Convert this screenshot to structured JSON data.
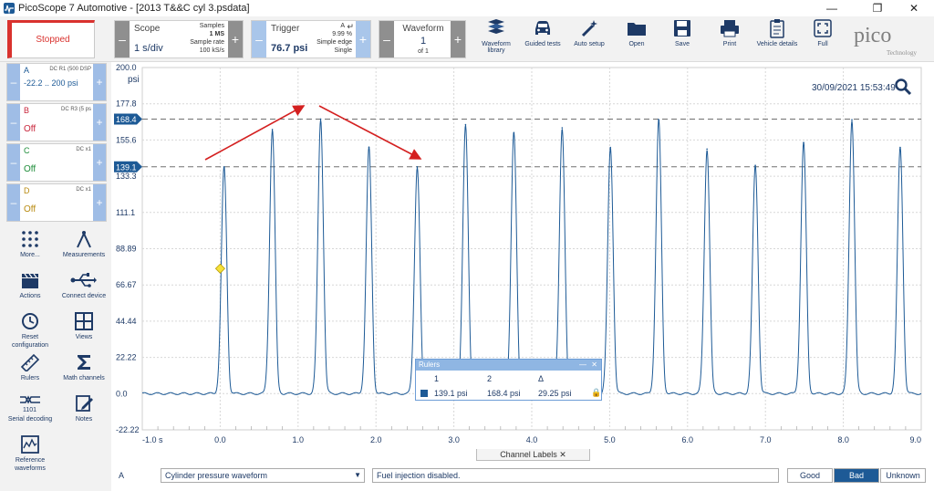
{
  "window": {
    "title": "PicoScope 7 Automotive - [2013 T&&C cyl 3.psdata]"
  },
  "run_status": {
    "label": "Stopped",
    "color": "#d9322e"
  },
  "scope_panel": {
    "label": "Scope",
    "value": "1 s/div",
    "samples_label": "Samples",
    "samples_value": "1 MS",
    "rate_label": "Sample rate",
    "rate_value": "100 kS/s"
  },
  "trigger_panel": {
    "label": "Trigger",
    "channel": "A",
    "percent": "9.99 %",
    "value": "76.7 psi",
    "type": "Simple edge",
    "mode": "Single"
  },
  "waveform_panel": {
    "label": "Waveform",
    "index": "1",
    "of": "of 1"
  },
  "toolbar": [
    {
      "label": "Waveform library",
      "icon": "books-icon"
    },
    {
      "label": "Guided tests",
      "icon": "car-icon"
    },
    {
      "label": "Auto setup",
      "icon": "magic-wand-icon"
    },
    {
      "label": "Open",
      "icon": "folder-icon"
    },
    {
      "label": "Save",
      "icon": "save-icon"
    },
    {
      "label": "Print",
      "icon": "printer-icon"
    },
    {
      "label": "Vehicle details",
      "icon": "clipboard-icon"
    },
    {
      "label": "Full",
      "icon": "fullscreen-icon"
    }
  ],
  "brand": {
    "name": "pico",
    "sub": "Technology"
  },
  "channels": [
    {
      "name": "A",
      "color": "#1d5a96",
      "value": "-22.2 .. 200 psi",
      "settings": "DC R1 (500 DSP"
    },
    {
      "name": "B",
      "color": "#c8253b",
      "value": "Off",
      "settings": "DC R3 (5 ps"
    },
    {
      "name": "C",
      "color": "#1e8c3a",
      "value": "Off",
      "settings": "DC x1"
    },
    {
      "name": "D",
      "color": "#b88a10",
      "value": "Off",
      "settings": "DC x1"
    }
  ],
  "sidebar_buttons": [
    {
      "label": "More...",
      "icon": "dots-grid-icon"
    },
    {
      "label": "Measurements",
      "icon": "compass-icon"
    },
    {
      "label": "Actions",
      "icon": "clapperboard-icon"
    },
    {
      "label": "Connect device",
      "icon": "usb-icon"
    },
    {
      "label": "Reset configuration",
      "icon": "reset-icon"
    },
    {
      "label": "Views",
      "icon": "views-grid-icon"
    },
    {
      "label": "Rulers",
      "icon": "ruler-icon"
    },
    {
      "label": "Math channels",
      "icon": "sigma-icon"
    },
    {
      "label": "Serial decoding",
      "icon": "serial-decoding-icon"
    },
    {
      "label": "Notes",
      "icon": "notes-icon"
    },
    {
      "label": "Reference waveforms",
      "icon": "reference-waveform-icon"
    }
  ],
  "timestamp": "30/09/2021 15:53:49",
  "ruler_marks": {
    "r1": "139.1",
    "r2": "168.4"
  },
  "rulers_window": {
    "title": "Rulers",
    "headers": [
      "",
      "1",
      "2",
      "Δ"
    ],
    "values": [
      "139.1 psi",
      "168.4 psi",
      "29.25 psi"
    ]
  },
  "chart_data": {
    "type": "line",
    "ylabel": "psi",
    "yticks": [
      "200.0",
      "177.8",
      "155.6",
      "133.3",
      "111.1",
      "88.89",
      "66.67",
      "44.44",
      "22.22",
      "0.0",
      "-22.22"
    ],
    "xticks": [
      "-1.0 s",
      "0.0",
      "1.0",
      "2.0",
      "3.0",
      "4.0",
      "5.0",
      "6.0",
      "7.0",
      "8.0",
      "9.0"
    ],
    "ylim": [
      -22.22,
      200
    ],
    "xlim": [
      -1,
      9
    ],
    "series": [
      {
        "color": "#1d5a96",
        "peaks": [
          {
            "x": 0.05,
            "y": 139
          },
          {
            "x": 0.67,
            "y": 162
          },
          {
            "x": 1.29,
            "y": 168.4
          },
          {
            "x": 1.91,
            "y": 151
          },
          {
            "x": 2.53,
            "y": 139.1
          },
          {
            "x": 3.15,
            "y": 165
          },
          {
            "x": 3.77,
            "y": 160
          },
          {
            "x": 4.39,
            "y": 163
          },
          {
            "x": 5.01,
            "y": 151
          },
          {
            "x": 5.63,
            "y": 168
          },
          {
            "x": 6.25,
            "y": 150
          },
          {
            "x": 6.87,
            "y": 140
          },
          {
            "x": 7.49,
            "y": 154
          },
          {
            "x": 8.11,
            "y": 168
          },
          {
            "x": 8.73,
            "y": 151
          }
        ]
      }
    ],
    "trigger_point": {
      "x": 0.0,
      "y": 76.7
    },
    "grid": true
  },
  "channel_labels": {
    "tab": "Channel Labels",
    "channel": "A",
    "selected": "Cylinder pressure waveform",
    "notes": "Fuel injection disabled.",
    "ratings": [
      "Good",
      "Bad",
      "Unknown"
    ],
    "active_rating": "Bad"
  }
}
